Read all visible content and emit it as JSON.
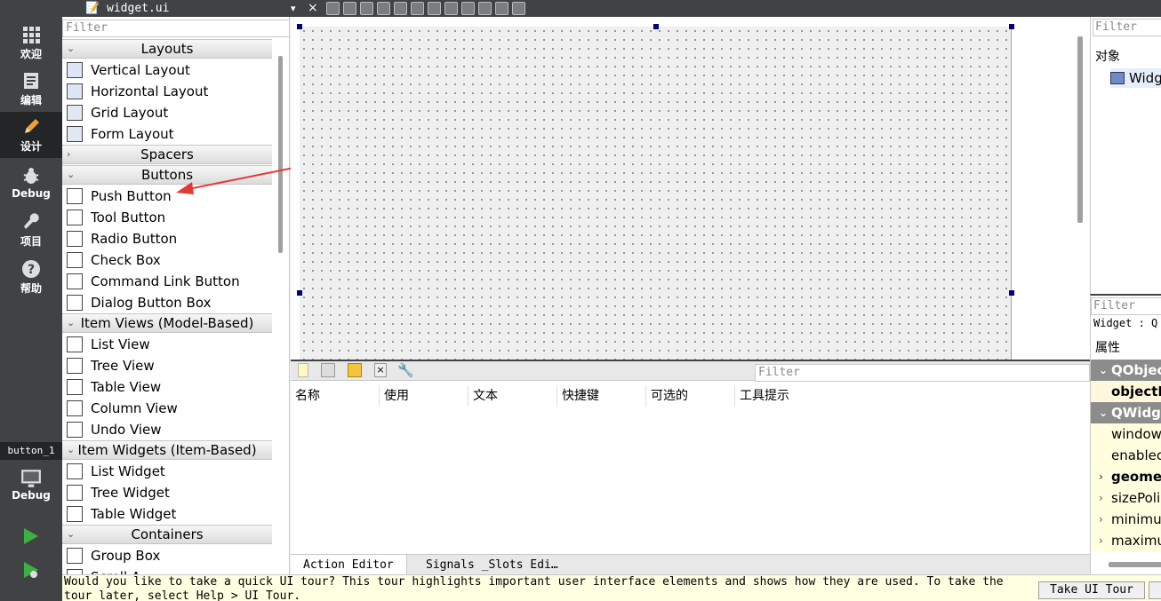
{
  "modes": [
    {
      "label": "欢迎"
    },
    {
      "label": "编辑"
    },
    {
      "label": "设计"
    },
    {
      "label": "Debug"
    },
    {
      "label": "项目"
    },
    {
      "label": "帮助"
    }
  ],
  "kit": {
    "target": "button_1",
    "label": "Debug"
  },
  "doc": {
    "name": "widget.ui"
  },
  "widgetbox": {
    "filter_placeholder": "Filter",
    "categories": [
      {
        "name": "Layouts",
        "items": [
          "Vertical Layout",
          "Horizontal Layout",
          "Grid Layout",
          "Form Layout"
        ]
      },
      {
        "name": "Spacers",
        "items": []
      },
      {
        "name": "Buttons",
        "items": [
          "Push Button",
          "Tool Button",
          "Radio Button",
          "Check Box",
          "Command Link Button",
          "Dialog Button Box"
        ]
      },
      {
        "name": "Item Views (Model-Based)",
        "items": [
          "List View",
          "Tree View",
          "Table View",
          "Column View",
          "Undo View"
        ]
      },
      {
        "name": "Item Widgets (Item-Based)",
        "items": [
          "List Widget",
          "Tree Widget",
          "Table Widget"
        ]
      },
      {
        "name": "Containers",
        "items": [
          "Group Box",
          "Scroll A"
        ]
      }
    ]
  },
  "action_editor": {
    "filter_placeholder": "Filter",
    "columns": [
      "名称",
      "使用",
      "文本",
      "快捷键",
      "可选的",
      "工具提示"
    ],
    "tabs": [
      "Action Editor",
      "Signals _Slots Edi…"
    ]
  },
  "object_inspector": {
    "filter_placeholder": "Filter",
    "header": "对象",
    "root": "Widg"
  },
  "property_editor": {
    "filter_placeholder": "Filter",
    "class_label": "Widget : Q",
    "header": "属性",
    "rows": [
      {
        "text": "QObjec",
        "kind": "cls"
      },
      {
        "text": "objectN",
        "kind": "bold"
      },
      {
        "text": "QWidge",
        "kind": "cls"
      },
      {
        "text": "window",
        "kind": "yel"
      },
      {
        "text": "enablec",
        "kind": "yel"
      },
      {
        "text": "geomet",
        "kind": "boldexp"
      },
      {
        "text": "sizePolic",
        "kind": "exp"
      },
      {
        "text": "minimu",
        "kind": "exp"
      },
      {
        "text": "maximu",
        "kind": "exp"
      }
    ]
  },
  "tour": {
    "line1": "Would you like to take a quick UI tour? This tour highlights important user interface elements and shows how they are used. To take the",
    "line2": "tour later, select Help > UI Tour.",
    "button": "Take UI Tour"
  },
  "accent": {
    "annotation_arrow": "#e53935",
    "selection_handle": "#000080",
    "mode_bar": "#404244"
  }
}
